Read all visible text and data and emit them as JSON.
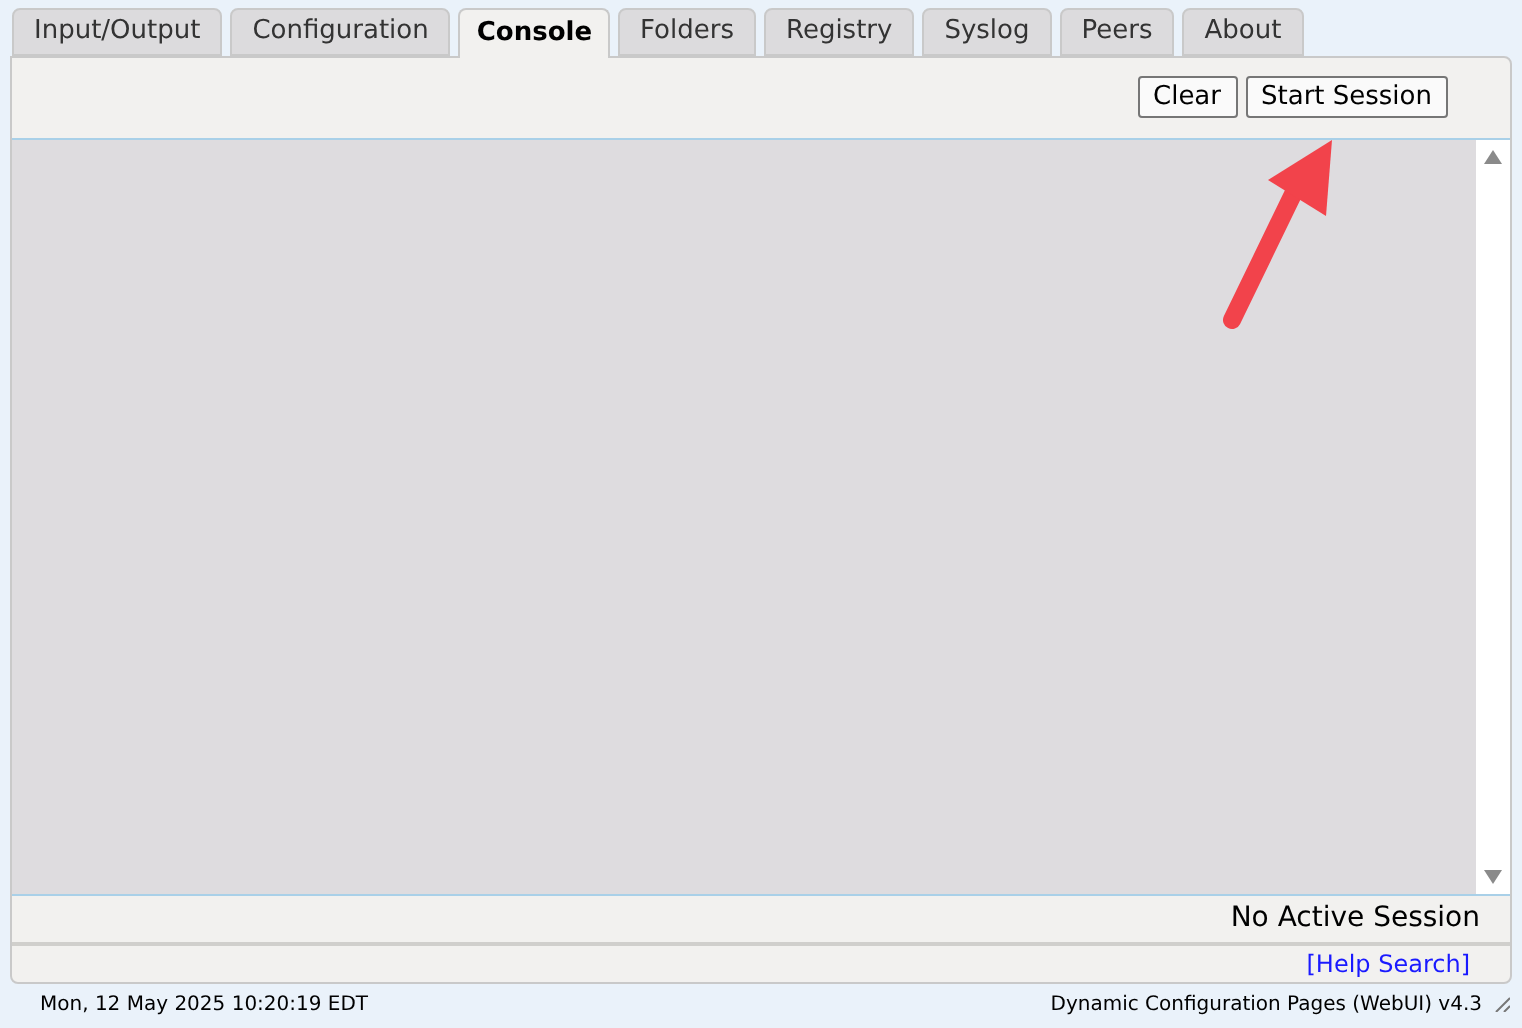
{
  "tabs": [
    {
      "label": "Input/Output",
      "selected": false
    },
    {
      "label": "Configuration",
      "selected": false
    },
    {
      "label": "Console",
      "selected": true
    },
    {
      "label": "Folders",
      "selected": false
    },
    {
      "label": "Registry",
      "selected": false
    },
    {
      "label": "Syslog",
      "selected": false
    },
    {
      "label": "Peers",
      "selected": false
    },
    {
      "label": "About",
      "selected": false
    }
  ],
  "toolbar": {
    "buttons": [
      "Clear",
      "Start Session"
    ]
  },
  "console": {
    "status": "No Active Session"
  },
  "help_link": "[Help Search]",
  "footer": {
    "datetime": "Mon, 12 May 2025 10:20:19 EDT",
    "version": "Dynamic Configuration Pages (WebUI) v4.3"
  }
}
